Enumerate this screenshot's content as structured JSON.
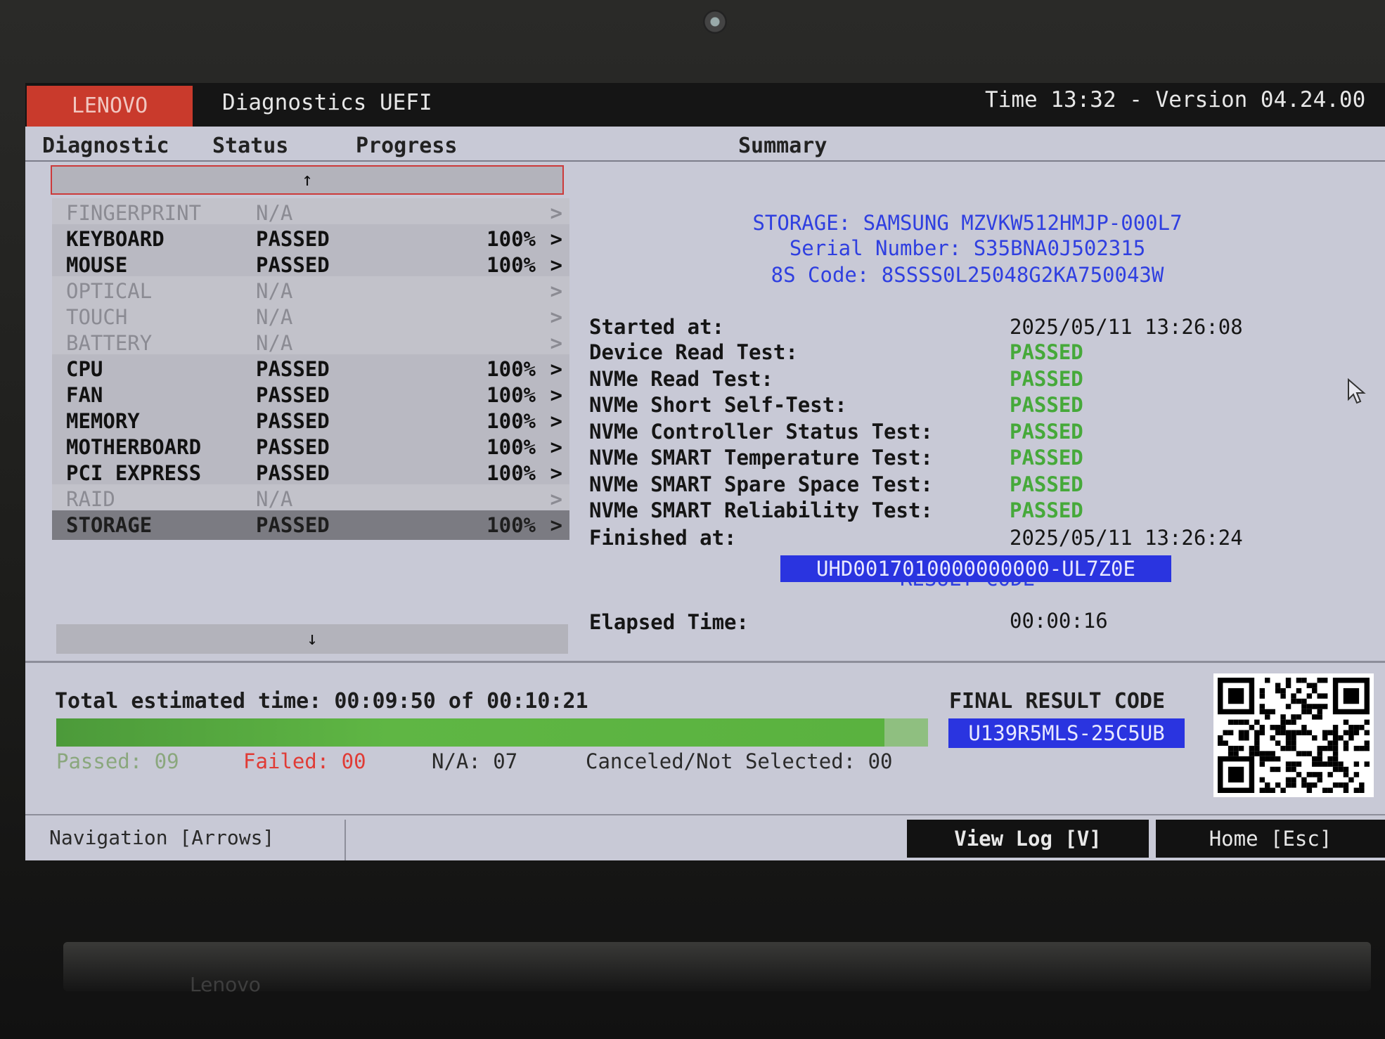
{
  "header": {
    "brand": "LENOVO",
    "title": "Diagnostics UEFI",
    "time_version": "Time 13:32 - Version 04.24.00"
  },
  "columns": {
    "diagnostic": "Diagnostic",
    "status": "Status",
    "progress": "Progress",
    "summary": "Summary"
  },
  "scroll": {
    "up": "↑",
    "down": "↓"
  },
  "diagnostics": [
    {
      "name": "FINGERPRINT",
      "status": "N/A",
      "progress": "",
      "chevron": ">"
    },
    {
      "name": "KEYBOARD",
      "status": "PASSED",
      "progress": "100%",
      "chevron": ">"
    },
    {
      "name": "MOUSE",
      "status": "PASSED",
      "progress": "100%",
      "chevron": ">"
    },
    {
      "name": "OPTICAL",
      "status": "N/A",
      "progress": "",
      "chevron": ">"
    },
    {
      "name": "TOUCH",
      "status": "N/A",
      "progress": "",
      "chevron": ">"
    },
    {
      "name": "BATTERY",
      "status": "N/A",
      "progress": "",
      "chevron": ">"
    },
    {
      "name": "CPU",
      "status": "PASSED",
      "progress": "100%",
      "chevron": ">"
    },
    {
      "name": "FAN",
      "status": "PASSED",
      "progress": "100%",
      "chevron": ">"
    },
    {
      "name": "MEMORY",
      "status": "PASSED",
      "progress": "100%",
      "chevron": ">"
    },
    {
      "name": "MOTHERBOARD",
      "status": "PASSED",
      "progress": "100%",
      "chevron": ">"
    },
    {
      "name": "PCI EXPRESS",
      "status": "PASSED",
      "progress": "100%",
      "chevron": ">"
    },
    {
      "name": "RAID",
      "status": "N/A",
      "progress": "",
      "chevron": ">"
    },
    {
      "name": "STORAGE",
      "status": "PASSED",
      "progress": "100%",
      "chevron": ">"
    }
  ],
  "summary": {
    "storage": "STORAGE: SAMSUNG MZVKW512HMJP-000L7",
    "serial": "Serial Number: S35BNA0J502315",
    "code8s": "8S Code: 8SSSS0L25048G2KA750043W",
    "started_label": "Started at:",
    "started_value": "2025/05/11 13:26:08",
    "tests": [
      {
        "label": "Device Read Test:",
        "result": "PASSED"
      },
      {
        "label": "NVMe Read Test:",
        "result": "PASSED"
      },
      {
        "label": "NVMe Short Self-Test:",
        "result": "PASSED"
      },
      {
        "label": "NVMe Controller Status Test:",
        "result": "PASSED"
      },
      {
        "label": "NVMe SMART Temperature Test:",
        "result": "PASSED"
      },
      {
        "label": "NVMe SMART Spare Space Test:",
        "result": "PASSED"
      },
      {
        "label": "NVMe SMART Reliability Test:",
        "result": "PASSED"
      }
    ],
    "finished_label": "Finished at:",
    "finished_value": "2025/05/11 13:26:24",
    "result_title": "RESULT CODE",
    "result_code": "UHD0017010000000000-UL7Z0E",
    "elapsed_label": "Elapsed Time:",
    "elapsed_value": "00:00:16"
  },
  "bottom": {
    "total_estimated": "Total estimated time: 00:09:50 of 00:10:21",
    "progress_fraction": 0.95,
    "passed": "Passed: 09",
    "failed": "Failed: 00",
    "na": "N/A: 07",
    "canceled": "Canceled/Not Selected: 00",
    "final_title": "FINAL RESULT CODE",
    "final_code": "U139R5MLS-25C5UB"
  },
  "footer": {
    "navigation": "Navigation [Arrows]",
    "view_log": "View Log [V]",
    "home": "Home [Esc]"
  },
  "laptop_logo": "Lenovo",
  "colors": {
    "brand_red": "#c93a2c",
    "accent_blue": "#2a34e0",
    "pass_green": "#46a93a",
    "fail_red": "#e03b35"
  }
}
